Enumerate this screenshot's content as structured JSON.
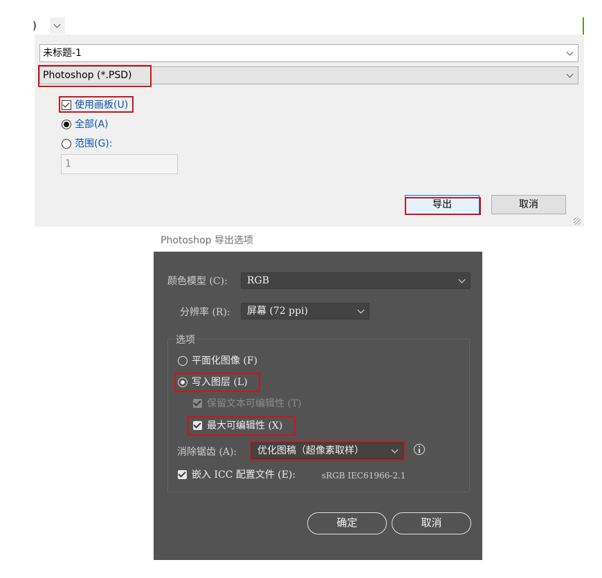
{
  "top_fragment": {
    "paren": ")"
  },
  "export_dialog": {
    "filename": "未标题-1",
    "format": "Photoshop (*.PSD)",
    "use_artboards_label": "使用画板(U)",
    "use_artboards_checked": true,
    "all_label": "全部(A)",
    "range_label": "范围(G):",
    "range_value": "1",
    "export_button": "导出",
    "cancel_button": "取消"
  },
  "ps_dialog": {
    "title": "Photoshop 导出选项",
    "color_model_label": "颜色模型 (C):",
    "color_model_value": "RGB",
    "resolution_label": "分辨率 (R):",
    "resolution_value": "屏幕 (72 ppi)",
    "options_group_label": "选项",
    "flatten_label": "平面化图像 (F)",
    "write_layers_label": "写入图层 (L)",
    "preserve_text_label": "保留文本可编辑性 (T)",
    "max_edit_label": "最大可编辑性 (X)",
    "antialias_label": "消除锯齿 (A):",
    "antialias_value": "优化图稿（超像素取样）",
    "embed_icc_label": "嵌入 ICC 配置文件 (E):",
    "icc_profile": "sRGB IEC61966-2.1",
    "ok_button": "确定",
    "cancel_button": "取消"
  },
  "colors": {
    "highlight_red": "#c8161d",
    "link_blue": "#0a55b0",
    "ps_panel": "#535353"
  }
}
